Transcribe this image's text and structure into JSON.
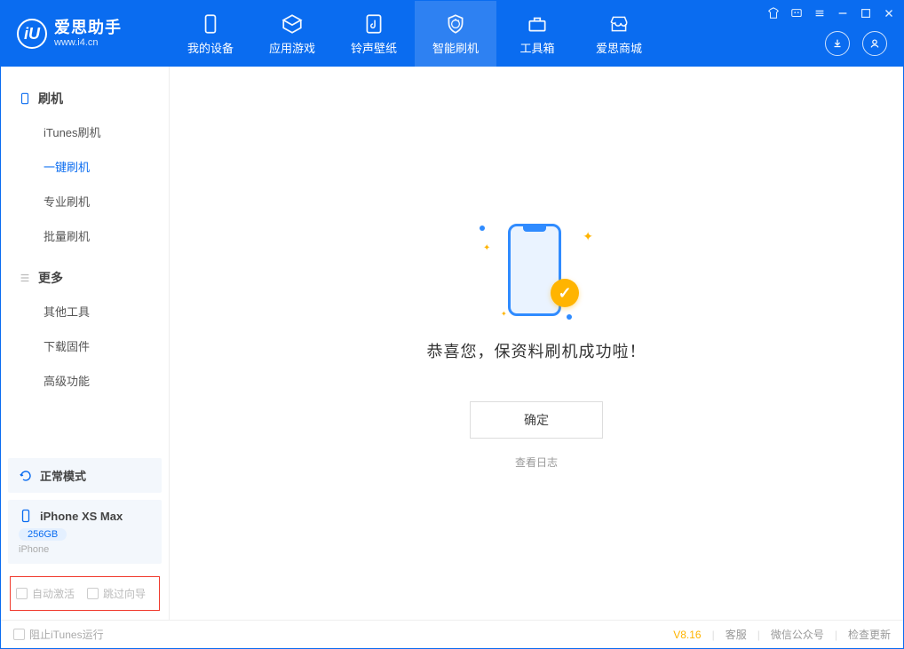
{
  "app": {
    "name": "爱思助手",
    "url": "www.i4.cn"
  },
  "tabs": [
    {
      "label": "我的设备",
      "icon": "phone"
    },
    {
      "label": "应用游戏",
      "icon": "box"
    },
    {
      "label": "铃声壁纸",
      "icon": "music"
    },
    {
      "label": "智能刷机",
      "icon": "shield",
      "active": true
    },
    {
      "label": "工具箱",
      "icon": "toolbox"
    },
    {
      "label": "爱思商城",
      "icon": "store"
    }
  ],
  "sidebar": {
    "section1": {
      "title": "刷机",
      "items": [
        "iTunes刷机",
        "一键刷机",
        "专业刷机",
        "批量刷机"
      ],
      "activeIndex": 1
    },
    "section2": {
      "title": "更多",
      "items": [
        "其他工具",
        "下载固件",
        "高级功能"
      ]
    }
  },
  "deviceCards": {
    "mode": {
      "label": "正常模式"
    },
    "device": {
      "name": "iPhone XS Max",
      "storage": "256GB",
      "type": "iPhone"
    }
  },
  "bottomOptions": {
    "opt1": "自动激活",
    "opt2": "跳过向导"
  },
  "main": {
    "successText": "恭喜您，保资料刷机成功啦！",
    "okButton": "确定",
    "viewLog": "查看日志"
  },
  "footer": {
    "blockItunes": "阻止iTunes运行",
    "version": "V8.16",
    "links": [
      "客服",
      "微信公众号",
      "检查更新"
    ]
  }
}
